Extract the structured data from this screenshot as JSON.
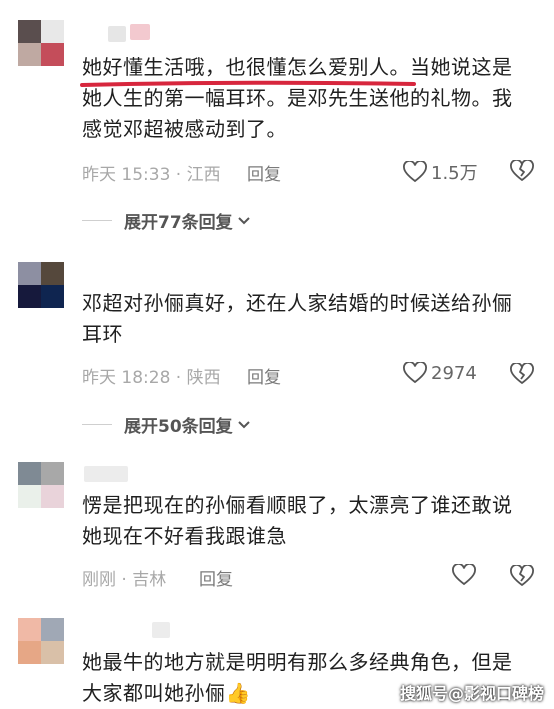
{
  "comments": [
    {
      "avatar_colors": [
        "#5a4e4e",
        "#e8e8e8",
        "#bfa9a2",
        "#c44d5a"
      ],
      "text": "她好懂生活哦，也很懂怎么爱别人。当她说这是她人生的第一幅耳环。是邓先生送他的礼物。我感觉邓超被感动到了。",
      "meta": "昨天 15:33 · 江西",
      "reply_label": "回复",
      "like_count": "1.5万",
      "expand_label": "展开77条回复"
    },
    {
      "avatar_colors": [
        "#8d8fa2",
        "#55483c",
        "#16193c",
        "#0f2550"
      ],
      "text": "邓超对孙俪真好，还在人家结婚的时候送给孙俪耳环",
      "meta": "昨天 18:28 · 陕西",
      "reply_label": "回复",
      "like_count": "2974",
      "expand_label": "展开50条回复"
    },
    {
      "avatar_colors": [
        "#7f8a94",
        "#a8a8a8",
        "#eaf0ea",
        "#e9d3da"
      ],
      "text": "愣是把现在的孙俪看顺眼了，太漂亮了谁还敢说她现在不好看我跟谁急",
      "meta": "刚刚 · 吉林",
      "reply_label": "回复",
      "like_count": ""
    },
    {
      "avatar_colors": [
        "#f0b9a6",
        "#a0a8b5",
        "#e6a786",
        "#d9c0a8"
      ],
      "text": "她最牛的地方就是明明有那么多经典角色，但是大家都叫她孙俪",
      "thumb_emoji": "👍"
    }
  ],
  "watermark": "搜狐号@影视口碑榜",
  "colors": {
    "highlight": "#d7263d",
    "icon": "#555555"
  }
}
